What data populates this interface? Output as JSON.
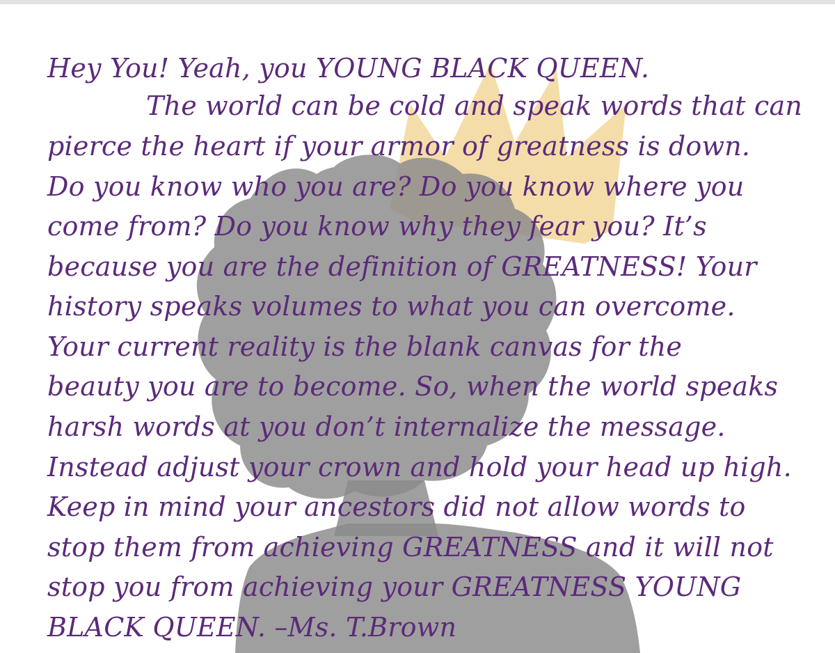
{
  "document": {
    "lines": [
      "Hey You! Yeah, you YOUNG BLACK QUEEN.",
      "The world can be cold and speak words that can",
      "pierce the heart if your armor of greatness is down.",
      "Do you know who you are? Do you know where you",
      "come from? Do you know why they fear you? It’s",
      "because you are the definition of GREATNESS! Your",
      "history speaks volumes to what you can overcome.",
      "Your current reality is the blank canvas for the",
      "beauty you are to become. So, when the world speaks",
      "harsh words at you don’t internalize the message.",
      "Instead adjust your crown and hold your head up high.",
      "Keep in mind your ancestors did not allow words to",
      "stop them from achieving GREATNESS and it will not",
      "stop you from achieving your GREATNESS YOUNG",
      "BLACK QUEEN. –Ms. T.Brown"
    ]
  },
  "colors": {
    "text": "#5b2a7a",
    "silhouette": "#8a8a8a",
    "crown": "#f2d79a",
    "background": "#ffffff"
  }
}
